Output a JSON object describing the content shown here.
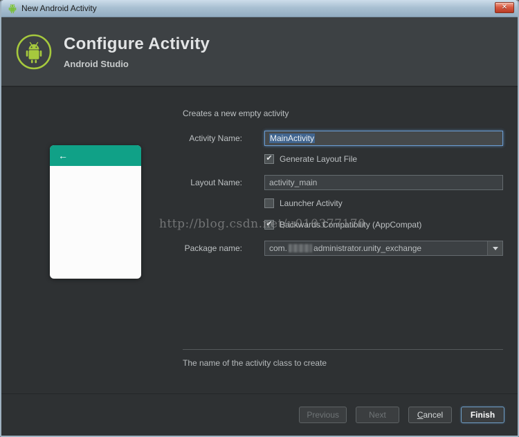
{
  "window": {
    "title": "New Android Activity",
    "close_glyph": "✕"
  },
  "header": {
    "title": "Configure Activity",
    "subtitle": "Android Studio"
  },
  "preview": {
    "back_arrow": "←"
  },
  "form": {
    "description": "Creates a new empty activity",
    "activity_name": {
      "label": "Activity Name:",
      "value": "MainActivity"
    },
    "generate_layout": {
      "label": "Generate Layout File",
      "checked": true,
      "glyph": "✔"
    },
    "layout_name": {
      "label": "Layout Name:",
      "value": "activity_main"
    },
    "launcher_activity": {
      "label": "Launcher Activity",
      "checked": false,
      "glyph": ""
    },
    "backwards_compat": {
      "label": "Backwards Compatibility (AppCompat)",
      "checked": true,
      "glyph": "✔"
    },
    "package_name": {
      "label": "Package name:",
      "prefix": "com.",
      "suffix": "administrator.unity_exchange"
    },
    "hint": "The name of the activity class to create"
  },
  "watermark": "http://blog.csdn.net/u010377170",
  "buttons": {
    "previous": "Previous",
    "next": "Next",
    "cancel_mnemonic": "C",
    "cancel_rest": "ancel",
    "finish": "Finish"
  },
  "colors": {
    "teal_header": "#10a187",
    "focus_border": "#6a9bd0",
    "selection": "#41658f",
    "finish_border": "#6f9fc8",
    "header_bg": "#3d4144",
    "content_bg": "#2e3133"
  }
}
